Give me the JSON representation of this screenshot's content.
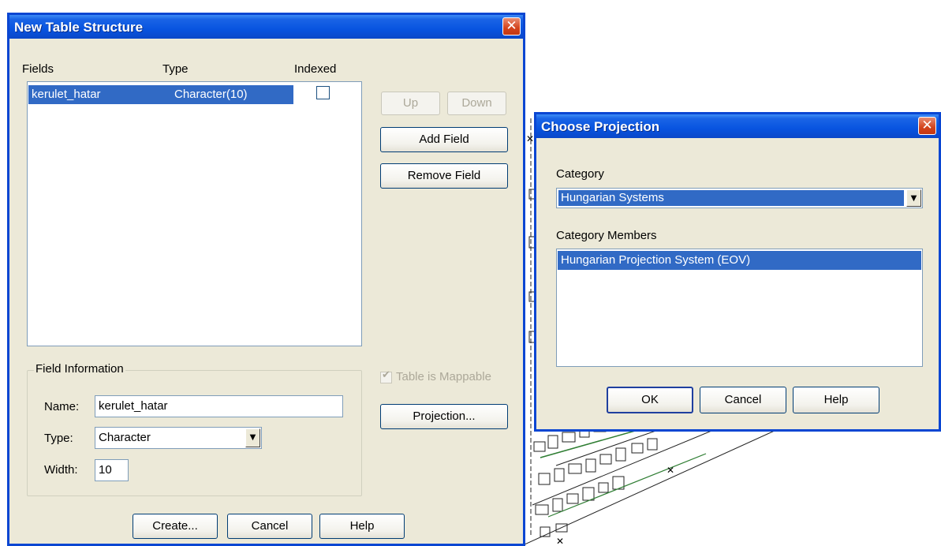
{
  "new_table": {
    "title": "New Table Structure",
    "close_glyph": "✕",
    "headers": {
      "fields": "Fields",
      "type": "Type",
      "indexed": "Indexed"
    },
    "rows": [
      {
        "field": "kerulet_hatar",
        "type": "Character(10)",
        "indexed": false
      }
    ],
    "buttons": {
      "up": "Up",
      "down": "Down",
      "add_field": "Add Field",
      "remove_field": "Remove Field",
      "projection": "Projection...",
      "create": "Create...",
      "cancel": "Cancel",
      "help": "Help"
    },
    "mappable_label": "Table is Mappable",
    "mappable_checked": true,
    "field_info": {
      "legend": "Field Information",
      "name_label": "Name:",
      "name_value": "kerulet_hatar",
      "type_label": "Type:",
      "type_value": "Character",
      "width_label": "Width:",
      "width_value": "10"
    }
  },
  "choose_projection": {
    "title": "Choose Projection",
    "close_glyph": "✕",
    "category_label": "Category",
    "category_value": "Hungarian Systems",
    "members_label": "Category Members",
    "members": [
      "Hungarian Projection System (EOV)"
    ],
    "buttons": {
      "ok": "OK",
      "cancel": "Cancel",
      "help": "Help"
    }
  },
  "colors": {
    "titlebar": "#0a46d2",
    "dialog_bg": "#ece9d8",
    "selection": "#316ac5",
    "close_button": "#d3431c",
    "map_lines": "#222222",
    "map_green": "#2e7d32"
  },
  "icons": {
    "dropdown": "chevron-down-icon",
    "close": "close-icon"
  }
}
